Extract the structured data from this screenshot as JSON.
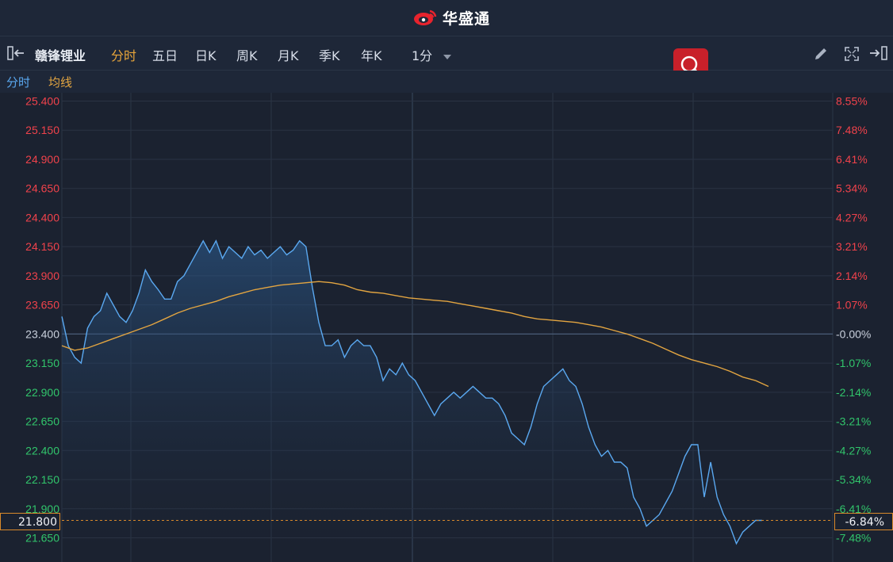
{
  "header": {
    "brand_name": "华盛通",
    "logo_icon": "weibo-eye-logo-icon"
  },
  "toolbar": {
    "stock_name": "赣锋锂业",
    "periods": [
      "分时",
      "五日",
      "日K",
      "周K",
      "月K",
      "季K",
      "年K"
    ],
    "active_period": "分时",
    "interval": "1分",
    "icons": [
      "panel-collapse-icon",
      "search-icon",
      "pencil-icon",
      "fullscreen-icon",
      "panel-expand-icon"
    ]
  },
  "legend": {
    "line1": "分时",
    "line2": "均线"
  },
  "colors": {
    "up": "#f0424b",
    "down": "#31c56b",
    "price_line": "#5aa8f0",
    "avg_line": "#e3a541",
    "accent": "#e8a53a",
    "search_bg": "#c8202a"
  },
  "chart_data": {
    "type": "line",
    "y_axis_left": [
      "25.400",
      "25.150",
      "24.900",
      "24.650",
      "24.400",
      "24.150",
      "23.900",
      "23.650",
      "23.400",
      "23.150",
      "22.900",
      "22.650",
      "22.400",
      "22.150",
      "21.900",
      "21.650"
    ],
    "y_axis_right": [
      "8.55%",
      "7.48%",
      "6.41%",
      "5.34%",
      "4.27%",
      "3.21%",
      "2.14%",
      "1.07%",
      "-0.00%",
      "-1.07%",
      "-2.14%",
      "-3.21%",
      "-4.27%",
      "-5.34%",
      "-6.41%",
      "-7.48%"
    ],
    "ylim": [
      21.55,
      25.45
    ],
    "prev_close": 23.4,
    "session_length": 241,
    "grid": true,
    "current_price": "21.800",
    "current_pct": "-6.84%",
    "series": [
      {
        "values": [
          23.55,
          23.3,
          23.2,
          23.15,
          23.45,
          23.55,
          23.6,
          23.75,
          23.65,
          23.55,
          23.5,
          23.6,
          23.75,
          23.95,
          23.85,
          23.78,
          23.7,
          23.7,
          23.85,
          23.9,
          24.0,
          24.1,
          24.2,
          24.1,
          24.2,
          24.05,
          24.15,
          24.1,
          24.05,
          24.15,
          24.08,
          24.12,
          24.05,
          24.1,
          24.15,
          24.08,
          24.12,
          24.2,
          24.15,
          23.8,
          23.5,
          23.3,
          23.3,
          23.35,
          23.2,
          23.3,
          23.35,
          23.3,
          23.3,
          23.2,
          23.0,
          23.1,
          23.05,
          23.15,
          23.05,
          23.0,
          22.9,
          22.8,
          22.7,
          22.8,
          22.85,
          22.9,
          22.85,
          22.9,
          22.95,
          22.9,
          22.85,
          22.85,
          22.8,
          22.7,
          22.55,
          22.5,
          22.45,
          22.6,
          22.8,
          22.95,
          23.0,
          23.05,
          23.1,
          23.0,
          22.95,
          22.8,
          22.6,
          22.45,
          22.35,
          22.4,
          22.3,
          22.3,
          22.25,
          22.0,
          21.9,
          21.75,
          21.8,
          21.85,
          21.95,
          22.05,
          22.2,
          22.35,
          22.45,
          22.45,
          22.0,
          22.3,
          22.0,
          21.85,
          21.75,
          21.6,
          21.7,
          21.75,
          21.8,
          21.8
        ],
        "step": 2
      },
      {
        "values": [
          23.3,
          23.26,
          23.28,
          23.32,
          23.36,
          23.4,
          23.44,
          23.48,
          23.53,
          23.58,
          23.62,
          23.65,
          23.68,
          23.72,
          23.75,
          23.78,
          23.8,
          23.82,
          23.83,
          23.84,
          23.85,
          23.84,
          23.82,
          23.78,
          23.76,
          23.75,
          23.73,
          23.71,
          23.7,
          23.69,
          23.68,
          23.66,
          23.64,
          23.62,
          23.6,
          23.58,
          23.55,
          23.53,
          23.52,
          23.51,
          23.5,
          23.48,
          23.46,
          23.43,
          23.4,
          23.36,
          23.32,
          23.27,
          23.22,
          23.18,
          23.15,
          23.12,
          23.08,
          23.03,
          23.0,
          22.95
        ],
        "step": 4
      }
    ]
  }
}
